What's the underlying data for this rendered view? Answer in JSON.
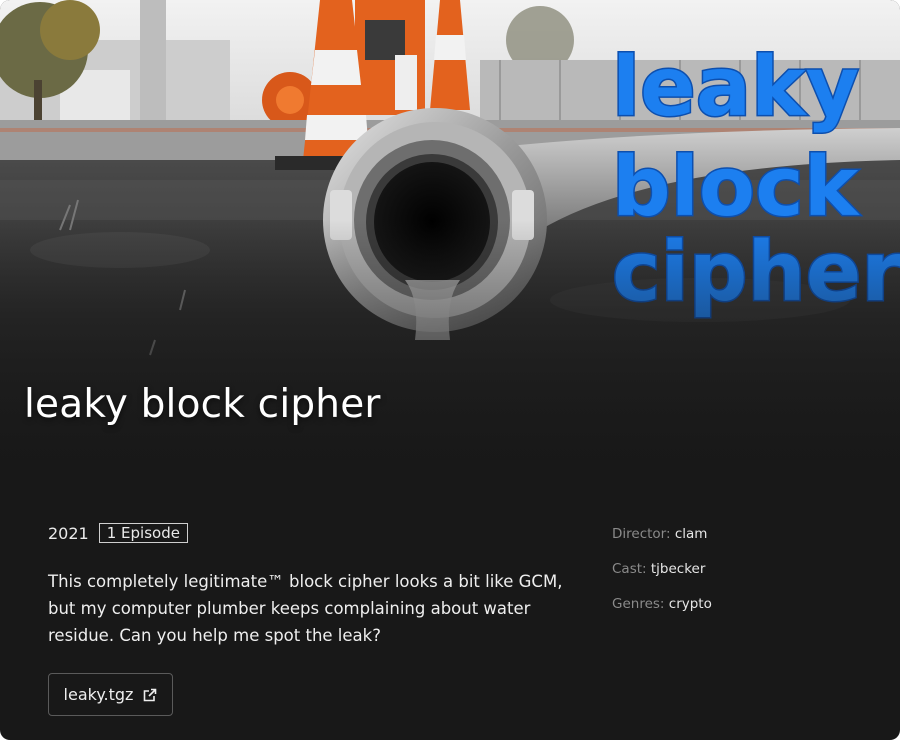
{
  "challenge": {
    "title": "leaky block cipher",
    "logo_text": [
      "leaky",
      "block",
      "cipher"
    ],
    "year": "2021",
    "episodes": "1 Episode",
    "description": "This completely legitimate™ block cipher looks a bit like GCM, but my computer plumber keeps complaining about water residue. Can you help me spot the leak?",
    "download": {
      "label": "leaky.tgz",
      "icon": "external-link-icon"
    }
  },
  "details": {
    "director_label": "Director:",
    "director": "clam",
    "cast_label": "Cast:",
    "cast": "tjbecker",
    "genres_label": "Genres:",
    "genres": "crypto"
  },
  "colors": {
    "background": "#181818",
    "logo_blue": "#1c7ff0",
    "cone_orange": "#e3621e",
    "muted_label": "#8a8a8a"
  }
}
